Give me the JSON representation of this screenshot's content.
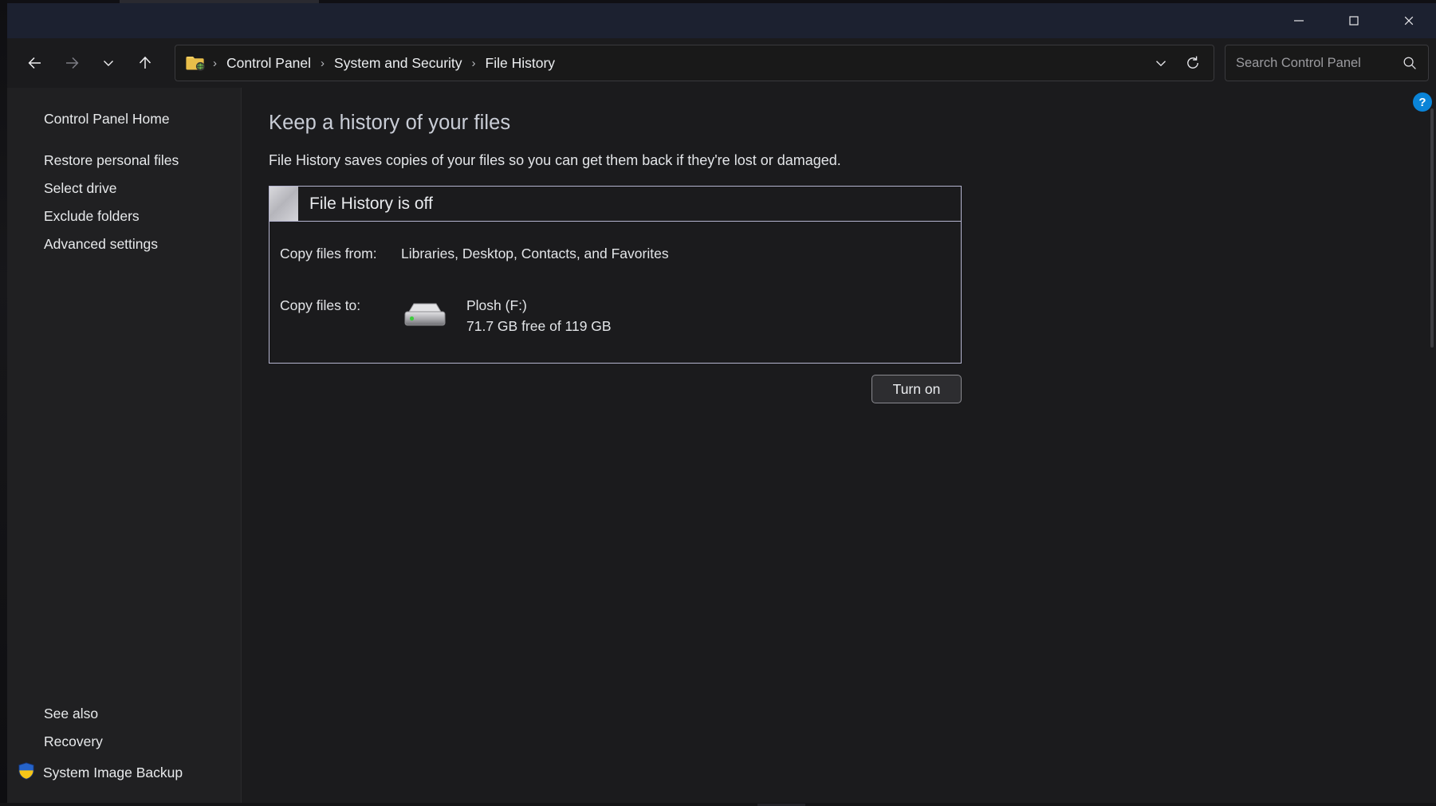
{
  "window": {
    "controls": {
      "minimize_label": "Minimize",
      "maximize_label": "Maximize",
      "close_label": "Close"
    }
  },
  "navbar": {
    "back_label": "Back",
    "forward_label": "Forward",
    "recent_label": "Recent locations",
    "up_label": "Up",
    "chevron_label": "Previous locations",
    "refresh_label": "Refresh",
    "breadcrumb": [
      {
        "label": "Control Panel"
      },
      {
        "label": "System and Security"
      },
      {
        "label": "File History"
      }
    ],
    "separator": "›"
  },
  "search": {
    "placeholder": "Search Control Panel",
    "value": "",
    "icon": "search-icon"
  },
  "sidebar": {
    "home_label": "Control Panel Home",
    "items": [
      {
        "label": "Restore personal files"
      },
      {
        "label": "Select drive"
      },
      {
        "label": "Exclude folders"
      },
      {
        "label": "Advanced settings"
      }
    ],
    "see_also_heading": "See also",
    "see_also_items": [
      {
        "label": "Recovery",
        "icon": ""
      },
      {
        "label": "System Image Backup",
        "icon": "uac-shield-icon"
      }
    ]
  },
  "main": {
    "title": "Keep a history of your files",
    "subtitle": "File History saves copies of your files so you can get them back if they're lost or damaged.",
    "status_panel": {
      "header": "File History is off",
      "rows": [
        {
          "label": "Copy files from:",
          "value": "Libraries, Desktop, Contacts, and Favorites"
        },
        {
          "label": "Copy files to:",
          "value": ""
        }
      ],
      "drive": {
        "name": "Plosh (F:)",
        "space": "71.7 GB free of 119 GB",
        "icon": "external-drive-icon",
        "led_color": "#3ecb3e"
      }
    },
    "turn_on_label": "Turn on",
    "help_label": "?"
  },
  "colors": {
    "titlebar": "#1c2130",
    "window_bg": "#1b1b1d",
    "sidebar_bg": "#202022",
    "panel_border": "#b4b4cf",
    "accent_help": "#0a84d8",
    "text_primary": "#e8eaec",
    "text_title": "#c9cdd6"
  }
}
